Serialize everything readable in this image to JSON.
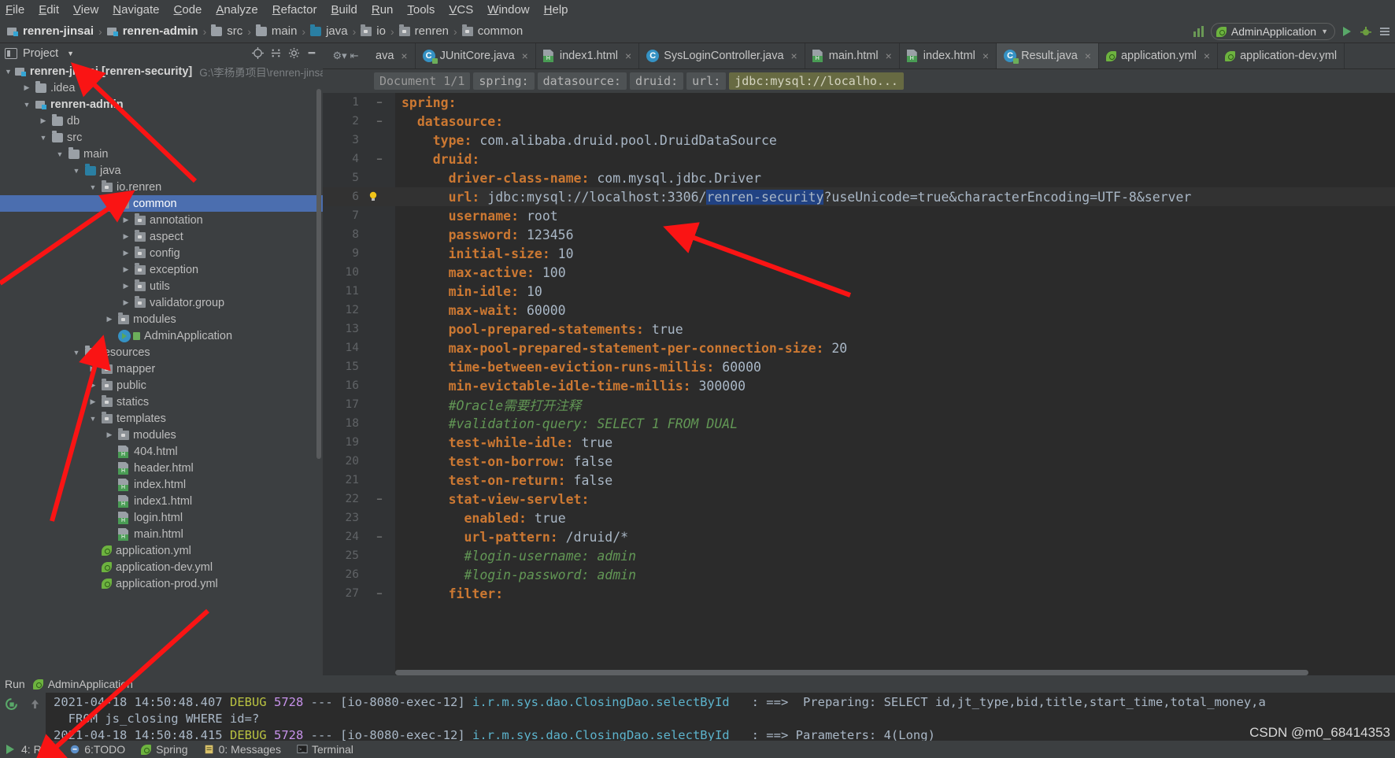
{
  "menubar": {
    "items": [
      "File",
      "Edit",
      "View",
      "Navigate",
      "Code",
      "Analyze",
      "Refactor",
      "Build",
      "Run",
      "Tools",
      "VCS",
      "Window",
      "Help"
    ]
  },
  "breadcrumb": {
    "items": [
      {
        "label": "renren-jinsai",
        "icon": "module-icon",
        "bold": true
      },
      {
        "label": "renren-admin",
        "icon": "module-icon",
        "bold": true
      },
      {
        "label": "src",
        "icon": "folder-icon",
        "bold": false
      },
      {
        "label": "main",
        "icon": "folder-icon",
        "bold": false
      },
      {
        "label": "java",
        "icon": "folder-blue-icon",
        "bold": false
      },
      {
        "label": "io",
        "icon": "package-icon",
        "bold": false
      },
      {
        "label": "renren",
        "icon": "package-icon",
        "bold": false
      },
      {
        "label": "common",
        "icon": "package-icon",
        "bold": false
      }
    ],
    "separator": "›"
  },
  "toolbar_right": {
    "run_config": "AdminApplication",
    "icons": [
      "stack-icon",
      "spring-leaf-icon",
      "chevron-down-icon",
      "run-icon",
      "debug-icon",
      "more-icon"
    ]
  },
  "project_panel": {
    "title": "Project",
    "header_icons": [
      "project-view-icon",
      "chevron-down-icon",
      "locate-icon",
      "collapse-all-icon",
      "gear-icon"
    ],
    "tree": [
      {
        "depth": 0,
        "arrow": "▼",
        "icon": "module-icon",
        "label": "renren-jinsai [renren-security]",
        "bold": true,
        "path": "G:\\李杨勇项目\\renren-jinsa",
        "selected": false
      },
      {
        "depth": 1,
        "arrow": "▶",
        "icon": "folder-icon",
        "label": ".idea",
        "bold": false,
        "selected": false
      },
      {
        "depth": 1,
        "arrow": "▼",
        "icon": "module-icon",
        "label": "renren-admin",
        "bold": true,
        "selected": false
      },
      {
        "depth": 2,
        "arrow": "▶",
        "icon": "folder-icon",
        "label": "db",
        "bold": false,
        "selected": false
      },
      {
        "depth": 2,
        "arrow": "▼",
        "icon": "folder-icon",
        "label": "src",
        "bold": false,
        "selected": false
      },
      {
        "depth": 3,
        "arrow": "▼",
        "icon": "folder-icon",
        "label": "main",
        "bold": false,
        "selected": false
      },
      {
        "depth": 4,
        "arrow": "▼",
        "icon": "folder-blue-icon",
        "label": "java",
        "bold": false,
        "selected": false
      },
      {
        "depth": 5,
        "arrow": "▼",
        "icon": "package-icon",
        "label": "io.renren",
        "bold": false,
        "selected": false
      },
      {
        "depth": 6,
        "arrow": "▼",
        "icon": "package-icon",
        "label": "common",
        "bold": false,
        "selected": true
      },
      {
        "depth": 7,
        "arrow": "▶",
        "icon": "package-icon",
        "label": "annotation",
        "bold": false,
        "selected": false
      },
      {
        "depth": 7,
        "arrow": "▶",
        "icon": "package-icon",
        "label": "aspect",
        "bold": false,
        "selected": false
      },
      {
        "depth": 7,
        "arrow": "▶",
        "icon": "package-icon",
        "label": "config",
        "bold": false,
        "selected": false
      },
      {
        "depth": 7,
        "arrow": "▶",
        "icon": "package-icon",
        "label": "exception",
        "bold": false,
        "selected": false
      },
      {
        "depth": 7,
        "arrow": "▶",
        "icon": "package-icon",
        "label": "utils",
        "bold": false,
        "selected": false
      },
      {
        "depth": 7,
        "arrow": "▶",
        "icon": "package-icon",
        "label": "validator.group",
        "bold": false,
        "selected": false
      },
      {
        "depth": 6,
        "arrow": "▶",
        "icon": "package-icon",
        "label": "modules",
        "bold": false,
        "selected": false
      },
      {
        "depth": 6,
        "arrow": "",
        "icon": "run-class-icon",
        "label": "AdminApplication",
        "bold": false,
        "selected": false
      },
      {
        "depth": 4,
        "arrow": "▼",
        "icon": "resources-icon",
        "label": "resources",
        "bold": false,
        "selected": false
      },
      {
        "depth": 5,
        "arrow": "▶",
        "icon": "package-icon",
        "label": "mapper",
        "bold": false,
        "selected": false
      },
      {
        "depth": 5,
        "arrow": "▶",
        "icon": "package-icon",
        "label": "public",
        "bold": false,
        "selected": false
      },
      {
        "depth": 5,
        "arrow": "▶",
        "icon": "package-icon",
        "label": "statics",
        "bold": false,
        "selected": false
      },
      {
        "depth": 5,
        "arrow": "▼",
        "icon": "package-icon",
        "label": "templates",
        "bold": false,
        "selected": false
      },
      {
        "depth": 6,
        "arrow": "▶",
        "icon": "package-icon",
        "label": "modules",
        "bold": false,
        "selected": false
      },
      {
        "depth": 6,
        "arrow": "",
        "icon": "html-file-icon",
        "label": "404.html",
        "bold": false,
        "selected": false
      },
      {
        "depth": 6,
        "arrow": "",
        "icon": "html-file-icon",
        "label": "header.html",
        "bold": false,
        "selected": false
      },
      {
        "depth": 6,
        "arrow": "",
        "icon": "html-file-icon",
        "label": "index.html",
        "bold": false,
        "selected": false
      },
      {
        "depth": 6,
        "arrow": "",
        "icon": "html-file-icon",
        "label": "index1.html",
        "bold": false,
        "selected": false
      },
      {
        "depth": 6,
        "arrow": "",
        "icon": "html-file-icon",
        "label": "login.html",
        "bold": false,
        "selected": false
      },
      {
        "depth": 6,
        "arrow": "",
        "icon": "html-file-icon",
        "label": "main.html",
        "bold": false,
        "selected": false
      },
      {
        "depth": 5,
        "arrow": "",
        "icon": "yml-file-icon",
        "label": "application.yml",
        "bold": false,
        "selected": false
      },
      {
        "depth": 5,
        "arrow": "",
        "icon": "yml-file-icon",
        "label": "application-dev.yml",
        "bold": false,
        "selected": false
      },
      {
        "depth": 5,
        "arrow": "",
        "icon": "yml-file-icon",
        "label": "application-prod.yml",
        "bold": false,
        "selected": false
      }
    ]
  },
  "editor_tabs": [
    {
      "label": "ava",
      "icon": "java-file-icon",
      "active": false,
      "closable": true,
      "truncated": true
    },
    {
      "label": "JUnitCore.java",
      "icon": "class-lock-icon",
      "active": false,
      "closable": true
    },
    {
      "label": "index1.html",
      "icon": "html-file-icon",
      "active": false,
      "closable": true
    },
    {
      "label": "SysLoginController.java",
      "icon": "class-icon",
      "active": false,
      "closable": true
    },
    {
      "label": "main.html",
      "icon": "html-file-icon",
      "active": false,
      "closable": true
    },
    {
      "label": "index.html",
      "icon": "html-file-icon",
      "active": false,
      "closable": true
    },
    {
      "label": "Result.java",
      "icon": "class-lock-icon",
      "active": true,
      "closable": true
    },
    {
      "label": "application.yml",
      "icon": "yml-file-icon",
      "active": false,
      "closable": true
    },
    {
      "label": "application-dev.yml",
      "icon": "yml-file-icon",
      "active": false,
      "closable": false
    }
  ],
  "editor_breadcrumb": {
    "chips": [
      "Document 1/1",
      "spring:",
      "datasource:",
      "druid:",
      "url:"
    ],
    "value_chip": "jdbc:mysql://localho..."
  },
  "code": {
    "lines": [
      {
        "n": 1,
        "fold": "−",
        "text": "spring:",
        "style": "key"
      },
      {
        "n": 2,
        "fold": "−",
        "text": "  datasource:",
        "style": "key"
      },
      {
        "n": 3,
        "fold": "",
        "text": "    type: com.alibaba.druid.pool.DruidDataSource",
        "style": "kv"
      },
      {
        "n": 4,
        "fold": "−",
        "text": "    druid:",
        "style": "key"
      },
      {
        "n": 5,
        "fold": "",
        "text": "      driver-class-name: com.mysql.jdbc.Driver",
        "style": "kv"
      },
      {
        "n": 6,
        "fold": "",
        "text": "      url: jdbc:mysql://localhost:3306/renren-security?useUnicode=true&characterEncoding=UTF-8&server",
        "style": "url",
        "current": true,
        "bulb": true,
        "selection": "renren-security"
      },
      {
        "n": 7,
        "fold": "",
        "text": "      username: root",
        "style": "kv"
      },
      {
        "n": 8,
        "fold": "",
        "text": "      password: 123456",
        "style": "kv"
      },
      {
        "n": 9,
        "fold": "",
        "text": "      initial-size: 10",
        "style": "kv"
      },
      {
        "n": 10,
        "fold": "",
        "text": "      max-active: 100",
        "style": "kv"
      },
      {
        "n": 11,
        "fold": "",
        "text": "      min-idle: 10",
        "style": "kv"
      },
      {
        "n": 12,
        "fold": "",
        "text": "      max-wait: 60000",
        "style": "kv"
      },
      {
        "n": 13,
        "fold": "",
        "text": "      pool-prepared-statements: true",
        "style": "kv"
      },
      {
        "n": 14,
        "fold": "",
        "text": "      max-pool-prepared-statement-per-connection-size: 20",
        "style": "kv"
      },
      {
        "n": 15,
        "fold": "",
        "text": "      time-between-eviction-runs-millis: 60000",
        "style": "kv"
      },
      {
        "n": 16,
        "fold": "",
        "text": "      min-evictable-idle-time-millis: 300000",
        "style": "kv"
      },
      {
        "n": 17,
        "fold": "",
        "text": "      #Oracle需要打开注释",
        "style": "comment"
      },
      {
        "n": 18,
        "fold": "",
        "text": "      #validation-query: SELECT 1 FROM DUAL",
        "style": "comment"
      },
      {
        "n": 19,
        "fold": "",
        "text": "      test-while-idle: true",
        "style": "kv"
      },
      {
        "n": 20,
        "fold": "",
        "text": "      test-on-borrow: false",
        "style": "kv"
      },
      {
        "n": 21,
        "fold": "",
        "text": "      test-on-return: false",
        "style": "kv"
      },
      {
        "n": 22,
        "fold": "−",
        "text": "      stat-view-servlet:",
        "style": "key"
      },
      {
        "n": 23,
        "fold": "",
        "text": "        enabled: true",
        "style": "kv"
      },
      {
        "n": 24,
        "fold": "−",
        "text": "        url-pattern: /druid/*",
        "style": "kv"
      },
      {
        "n": 25,
        "fold": "",
        "text": "        #login-username: admin",
        "style": "comment"
      },
      {
        "n": 26,
        "fold": "",
        "text": "        #login-password: admin",
        "style": "comment"
      },
      {
        "n": 27,
        "fold": "−",
        "text": "      filter:",
        "style": "key"
      }
    ]
  },
  "run_panel": {
    "title": "Run",
    "config_name": "AdminApplication",
    "toolbar_icons": [
      "rerun-icon",
      "up-arrow-icon",
      "expand-icon",
      "expand2-icon"
    ],
    "console_lines": [
      {
        "date": "2021-04-18 14:50:48.407",
        "level": "DEBUG",
        "pid": "5728",
        "dashes": "---",
        "thread": "[io-8080-exec-12]",
        "logger": "i.r.m.sys.dao.ClosingDao.selectById",
        "sep": ":",
        "msg": "==>  Preparing: SELECT id,jt_type,bid,title,start_time,total_money,a"
      },
      {
        "plain": "  FROM js_closing WHERE id=?"
      },
      {
        "date": "2021-04-18 14:50:48.415",
        "level": "DEBUG",
        "pid": "5728",
        "dashes": "---",
        "thread": "[io-8080-exec-12]",
        "logger": "i.r.m.sys.dao.ClosingDao.selectById",
        "sep": ":",
        "msg": "==> Parameters: 4(Long)"
      }
    ]
  },
  "statusbar": {
    "items": [
      {
        "label": "4: Run",
        "icon": "run-icon"
      },
      {
        "label": "6:TODO",
        "icon": "todo-icon"
      },
      {
        "label": "Spring",
        "icon": "spring-leaf-icon"
      },
      {
        "label": "0: Messages",
        "icon": "messages-icon"
      },
      {
        "label": "Terminal",
        "icon": "terminal-icon"
      }
    ]
  },
  "watermark": "CSDN @m0_68414353",
  "colors": {
    "accent_selection": "#4b6eaf",
    "editor_bg": "#2b2b2b",
    "panel_bg": "#3c3f41",
    "keyword": "#cc7832",
    "comment": "#629755",
    "text": "#a9b7c6",
    "annotation_arrow": "#fa1414"
  }
}
